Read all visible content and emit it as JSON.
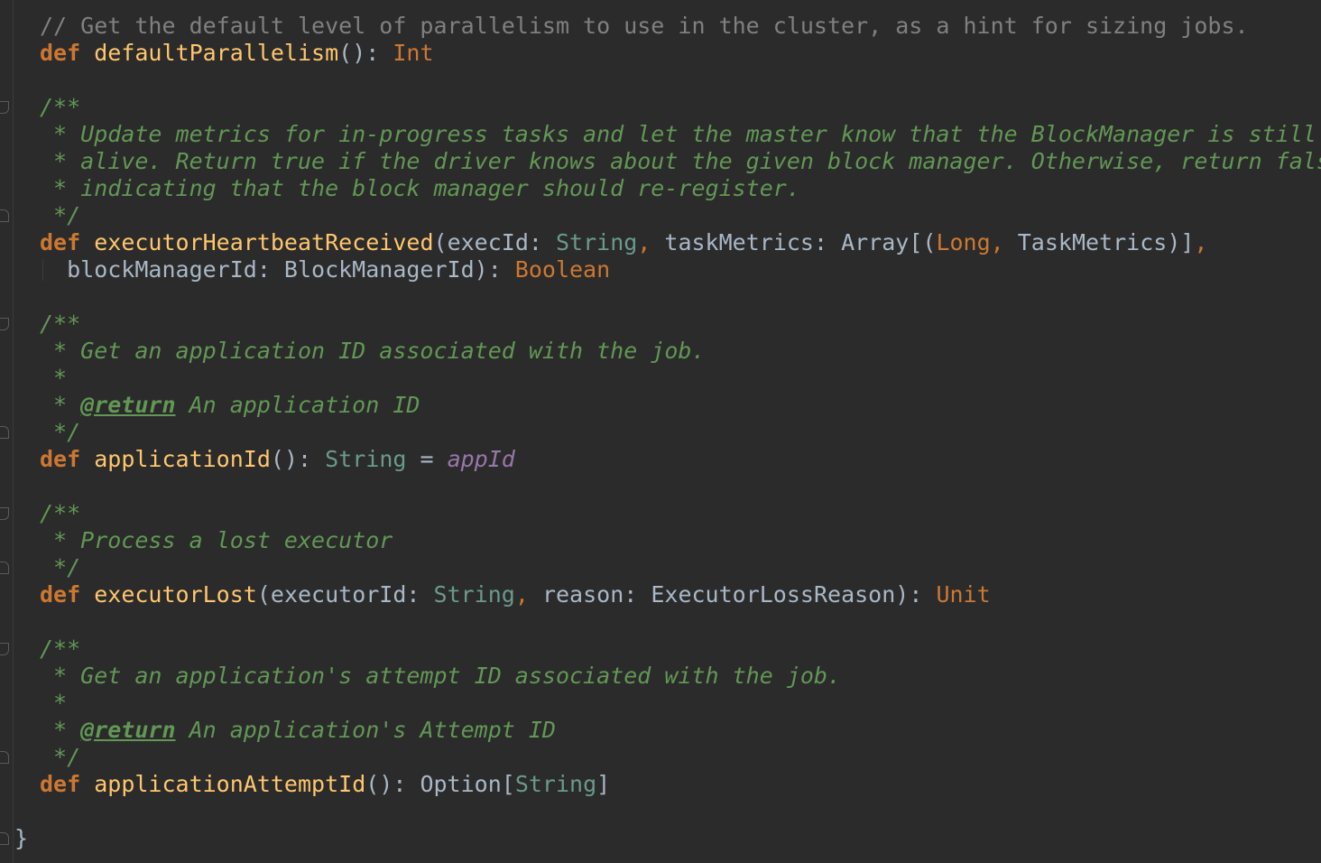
{
  "editor": {
    "background": "#2b2b2b",
    "colors": {
      "keyword": "#cc7832",
      "function": "#ffc66d",
      "plain": "#a9b7c6",
      "doc_comment": "#629755",
      "line_comment": "#808080",
      "string_type": "#6a9a8c",
      "field": "#9876aa"
    },
    "lines": [
      {
        "spans": [
          {
            "c": "lc",
            "t": "// Get the default level of parallelism to use in the cluster, as a hint for sizing jobs."
          }
        ]
      },
      {
        "spans": [
          {
            "c": "k",
            "t": "def "
          },
          {
            "c": "fn",
            "t": "defaultParallelism"
          },
          {
            "c": "p",
            "t": "(): "
          },
          {
            "c": "t",
            "t": "Int"
          }
        ]
      },
      {
        "spans": []
      },
      {
        "spans": [
          {
            "c": "dc",
            "t": "/**"
          }
        ]
      },
      {
        "spans": [
          {
            "c": "dc",
            "t": " * Update metrics for in-progress tasks and let the master know that the BlockManager is still"
          }
        ]
      },
      {
        "spans": [
          {
            "c": "dc",
            "t": " * alive. Return true if the driver knows about the given block manager. Otherwise, return false,"
          }
        ]
      },
      {
        "spans": [
          {
            "c": "dc",
            "t": " * indicating that the block manager should re-register."
          }
        ]
      },
      {
        "spans": [
          {
            "c": "dc",
            "t": " */"
          }
        ]
      },
      {
        "spans": [
          {
            "c": "k",
            "t": "def "
          },
          {
            "c": "fn",
            "t": "executorHeartbeatReceived"
          },
          {
            "c": "p",
            "t": "(execId: "
          },
          {
            "c": "s",
            "t": "String"
          },
          {
            "c": "t",
            "t": ", "
          },
          {
            "c": "p",
            "t": "taskMetrics: Array[("
          },
          {
            "c": "t",
            "t": "Long, "
          },
          {
            "c": "p",
            "t": "TaskMetrics)]"
          },
          {
            "c": "t",
            "t": ","
          }
        ]
      },
      {
        "guide": true,
        "spans": [
          {
            "c": "p",
            "t": "  blockManagerId: BlockManagerId): "
          },
          {
            "c": "t",
            "t": "Boolean"
          }
        ]
      },
      {
        "spans": []
      },
      {
        "spans": [
          {
            "c": "dc",
            "t": "/**"
          }
        ]
      },
      {
        "spans": [
          {
            "c": "dc",
            "t": " * Get an application ID associated with the job."
          }
        ]
      },
      {
        "spans": [
          {
            "c": "dc",
            "t": " *"
          }
        ]
      },
      {
        "spans": [
          {
            "c": "dc",
            "t": " * "
          },
          {
            "c": "tag",
            "t": "@return"
          },
          {
            "c": "dc",
            "t": " An application ID"
          }
        ]
      },
      {
        "spans": [
          {
            "c": "dc",
            "t": " */"
          }
        ]
      },
      {
        "spans": [
          {
            "c": "k",
            "t": "def "
          },
          {
            "c": "fn",
            "t": "applicationId"
          },
          {
            "c": "p",
            "t": "(): "
          },
          {
            "c": "s",
            "t": "String"
          },
          {
            "c": "p",
            "t": " = "
          },
          {
            "c": "purple",
            "t": "appId"
          }
        ]
      },
      {
        "spans": []
      },
      {
        "spans": [
          {
            "c": "dc",
            "t": "/**"
          }
        ]
      },
      {
        "spans": [
          {
            "c": "dc",
            "t": " * Process a lost executor"
          }
        ]
      },
      {
        "spans": [
          {
            "c": "dc",
            "t": " */"
          }
        ]
      },
      {
        "spans": [
          {
            "c": "k",
            "t": "def "
          },
          {
            "c": "fn",
            "t": "executorLost"
          },
          {
            "c": "p",
            "t": "(executorId: "
          },
          {
            "c": "s",
            "t": "String"
          },
          {
            "c": "t",
            "t": ", "
          },
          {
            "c": "p",
            "t": "reason: ExecutorLossReason): "
          },
          {
            "c": "t",
            "t": "Unit"
          }
        ]
      },
      {
        "spans": []
      },
      {
        "spans": [
          {
            "c": "dc",
            "t": "/**"
          }
        ]
      },
      {
        "spans": [
          {
            "c": "dc",
            "t": " * Get an application's attempt ID associated with the job."
          }
        ]
      },
      {
        "spans": [
          {
            "c": "dc",
            "t": " *"
          }
        ]
      },
      {
        "spans": [
          {
            "c": "dc",
            "t": " * "
          },
          {
            "c": "tag",
            "t": "@return"
          },
          {
            "c": "dc",
            "t": " An application's Attempt ID"
          }
        ]
      },
      {
        "spans": [
          {
            "c": "dc",
            "t": " */"
          }
        ]
      },
      {
        "spans": [
          {
            "c": "k",
            "t": "def "
          },
          {
            "c": "fn",
            "t": "applicationAttemptId"
          },
          {
            "c": "p",
            "t": "(): Option["
          },
          {
            "c": "s",
            "t": "String"
          },
          {
            "c": "p",
            "t": "]"
          }
        ]
      },
      {
        "spans": []
      },
      {
        "outdent": true,
        "spans": [
          {
            "c": "p",
            "t": "}"
          }
        ]
      }
    ]
  }
}
